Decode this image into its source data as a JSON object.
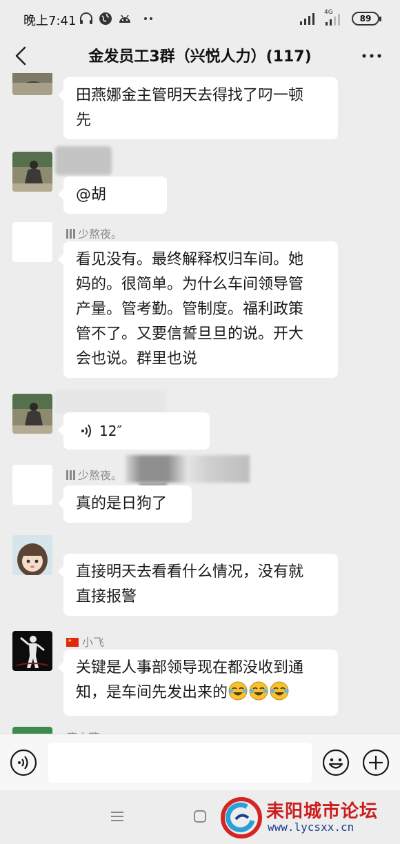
{
  "status_bar": {
    "time": "晚上7:41",
    "network": "4G",
    "battery": "89"
  },
  "header": {
    "title": "金发员工3群（兴悦人力）(117)"
  },
  "messages": [
    {
      "nickname": "",
      "text": "田燕娜金主管明天去得找了叼一顿\n先"
    },
    {
      "nickname": "",
      "text": "@胡"
    },
    {
      "nickname": "少熬夜。",
      "text": "看见没有。最终解释权归车间。她\n妈的。很简单。为什么车间领导管\n产量。管考勤。管制度。福利政策\n管不了。又要信誓旦旦的说。开大\n会也说。群里也说"
    },
    {
      "nickname": "",
      "voice_duration": "12″"
    },
    {
      "nickname": "少熬夜。",
      "text": "真的是日狗了"
    },
    {
      "nickname": "",
      "text": "直接明天去看看什么情况，没有就\n直接报警"
    },
    {
      "nickname": "小飞",
      "text": "关键是人事部领导现在都没收到通\n知，是车间先发出来的"
    },
    {
      "nickname": "唐小燕"
    }
  ],
  "input_bar": {
    "voice_icon": "voice-icon",
    "emoji_icon": "emoji-icon",
    "plus_icon": "plus-icon"
  },
  "watermark": {
    "name": "耒阳城市论坛",
    "url": "www.lycsxx.cn"
  }
}
